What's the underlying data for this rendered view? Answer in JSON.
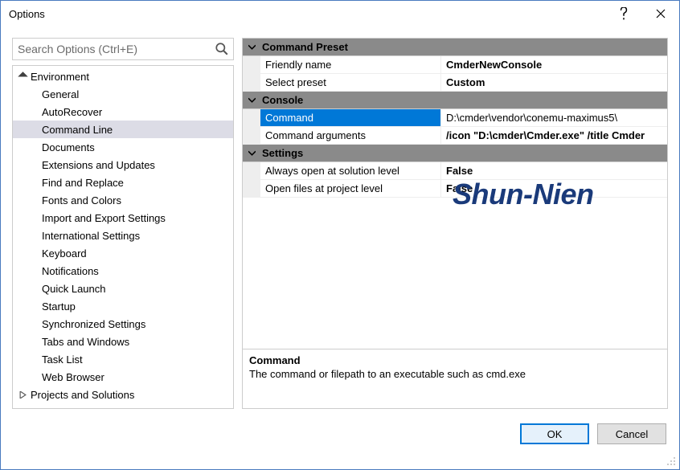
{
  "window": {
    "title": "Options"
  },
  "search": {
    "placeholder": "Search Options (Ctrl+E)"
  },
  "tree": {
    "items": [
      {
        "label": "Environment",
        "level": 0,
        "expanded": true
      },
      {
        "label": "General",
        "level": 1
      },
      {
        "label": "AutoRecover",
        "level": 1
      },
      {
        "label": "Command Line",
        "level": 1,
        "selected": true
      },
      {
        "label": "Documents",
        "level": 1
      },
      {
        "label": "Extensions and Updates",
        "level": 1
      },
      {
        "label": "Find and Replace",
        "level": 1
      },
      {
        "label": "Fonts and Colors",
        "level": 1
      },
      {
        "label": "Import and Export Settings",
        "level": 1
      },
      {
        "label": "International Settings",
        "level": 1
      },
      {
        "label": "Keyboard",
        "level": 1
      },
      {
        "label": "Notifications",
        "level": 1
      },
      {
        "label": "Quick Launch",
        "level": 1
      },
      {
        "label": "Startup",
        "level": 1
      },
      {
        "label": "Synchronized Settings",
        "level": 1
      },
      {
        "label": "Tabs and Windows",
        "level": 1
      },
      {
        "label": "Task List",
        "level": 1
      },
      {
        "label": "Web Browser",
        "level": 1
      },
      {
        "label": "Projects and Solutions",
        "level": 0,
        "expanded": false
      }
    ]
  },
  "grid": {
    "categories": [
      {
        "name": "Command Preset",
        "rows": [
          {
            "name": "Friendly name",
            "value": "CmderNewConsole"
          },
          {
            "name": "Select preset",
            "value": "Custom"
          }
        ]
      },
      {
        "name": "Console",
        "rows": [
          {
            "name": "Command",
            "value": "D:\\cmder\\vendor\\conemu-maximus5\\",
            "selected": true
          },
          {
            "name": "Command arguments",
            "value": "/icon \"D:\\cmder\\Cmder.exe\" /title Cmder"
          }
        ]
      },
      {
        "name": "Settings",
        "rows": [
          {
            "name": "Always open at solution level",
            "value": "False"
          },
          {
            "name": "Open files at project level",
            "value": "False"
          }
        ]
      }
    ]
  },
  "description": {
    "title": "Command",
    "text": "The command or filepath to an executable such as cmd.exe"
  },
  "buttons": {
    "ok": "OK",
    "cancel": "Cancel"
  },
  "watermark": "Shun-Nien"
}
